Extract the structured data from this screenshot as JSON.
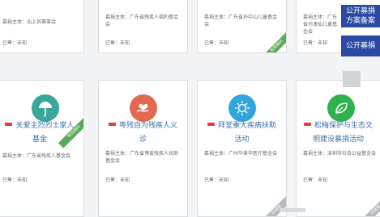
{
  "top_row": [
    {
      "sponsor": "募捐主体：汕上员赛事会",
      "date": "已筹：未知",
      "ribbon": ""
    },
    {
      "sponsor": "募捐主体：广东省残疾人福利基金会",
      "date": "已筹：未知",
      "ribbon": ""
    },
    {
      "sponsor": "募捐主体：广东省孙中山儿童基金会",
      "date": "已筹：未知",
      "ribbon": "有效期内"
    },
    {
      "sponsor": "募捐主体：广东省孙逸仙儿童基金会",
      "date": "已筹：未知",
      "ribbon": ""
    }
  ],
  "bottom_row": [
    {
      "icon": "umbrella-icon",
      "color": "#3aa79a",
      "title": "关爱主烈烈士家人基金",
      "sponsor": "募捐主体：广东省残疾人基金会",
      "date": "已筹：未知",
      "ribbon": "有效期内"
    },
    {
      "icon": "hand-heart-icon",
      "color": "#e06a50",
      "title": "粤残自为残疾人义诊",
      "sponsor": "募捐主体：广东省博爱残疾人扶助基金会",
      "date": "已筹：未知",
      "ribbon": ""
    },
    {
      "icon": "sun-icon",
      "color": "#2fa6e0",
      "title": "拜堂重大疾病扶助活动",
      "sponsor": "募捐主体：广州华美华医疗基金会",
      "date": "已筹：未知",
      "ribbon": "已结束"
    },
    {
      "icon": "leaf-icon",
      "color": "#2fb24e",
      "title": "松梅保护与生态文明建设募捐活动",
      "sponsor": "募捐主体：深圳市社会公益基金会",
      "date": "已筹：未知",
      "ribbon": "已结束"
    }
  ],
  "side": {
    "btn1": "公开募捐方案备案",
    "btn2": "公开募捐"
  }
}
